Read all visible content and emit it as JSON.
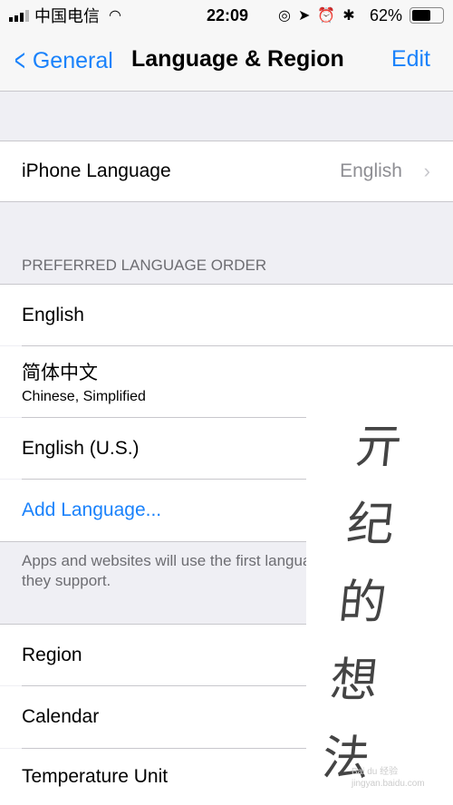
{
  "status": {
    "carrier": "中国电信",
    "time": "22:09",
    "battery": "62%",
    "battery_level": 0.62
  },
  "nav": {
    "back": "General",
    "title": "Language & Region",
    "edit": "Edit"
  },
  "iphone_language": {
    "label": "iPhone Language",
    "value": "English"
  },
  "preferred": {
    "header": "PREFERRED LANGUAGE ORDER",
    "items": [
      {
        "label": "English"
      },
      {
        "label": "简体中文",
        "sub": "Chinese, Simplified"
      },
      {
        "label": "English (U.S.)"
      }
    ],
    "add": "Add Language...",
    "footer": "Apps and websites will use the first language in this list that they support."
  },
  "region_rows": [
    "Region",
    "Calendar",
    "Temperature Unit"
  ],
  "overlay": {
    "handwriting": "亓纪的想法",
    "watermark": "Bai du 经验 jingyan.baidu.com"
  },
  "colors": {
    "accent": "#1a82fb",
    "background": "#efeff4"
  }
}
